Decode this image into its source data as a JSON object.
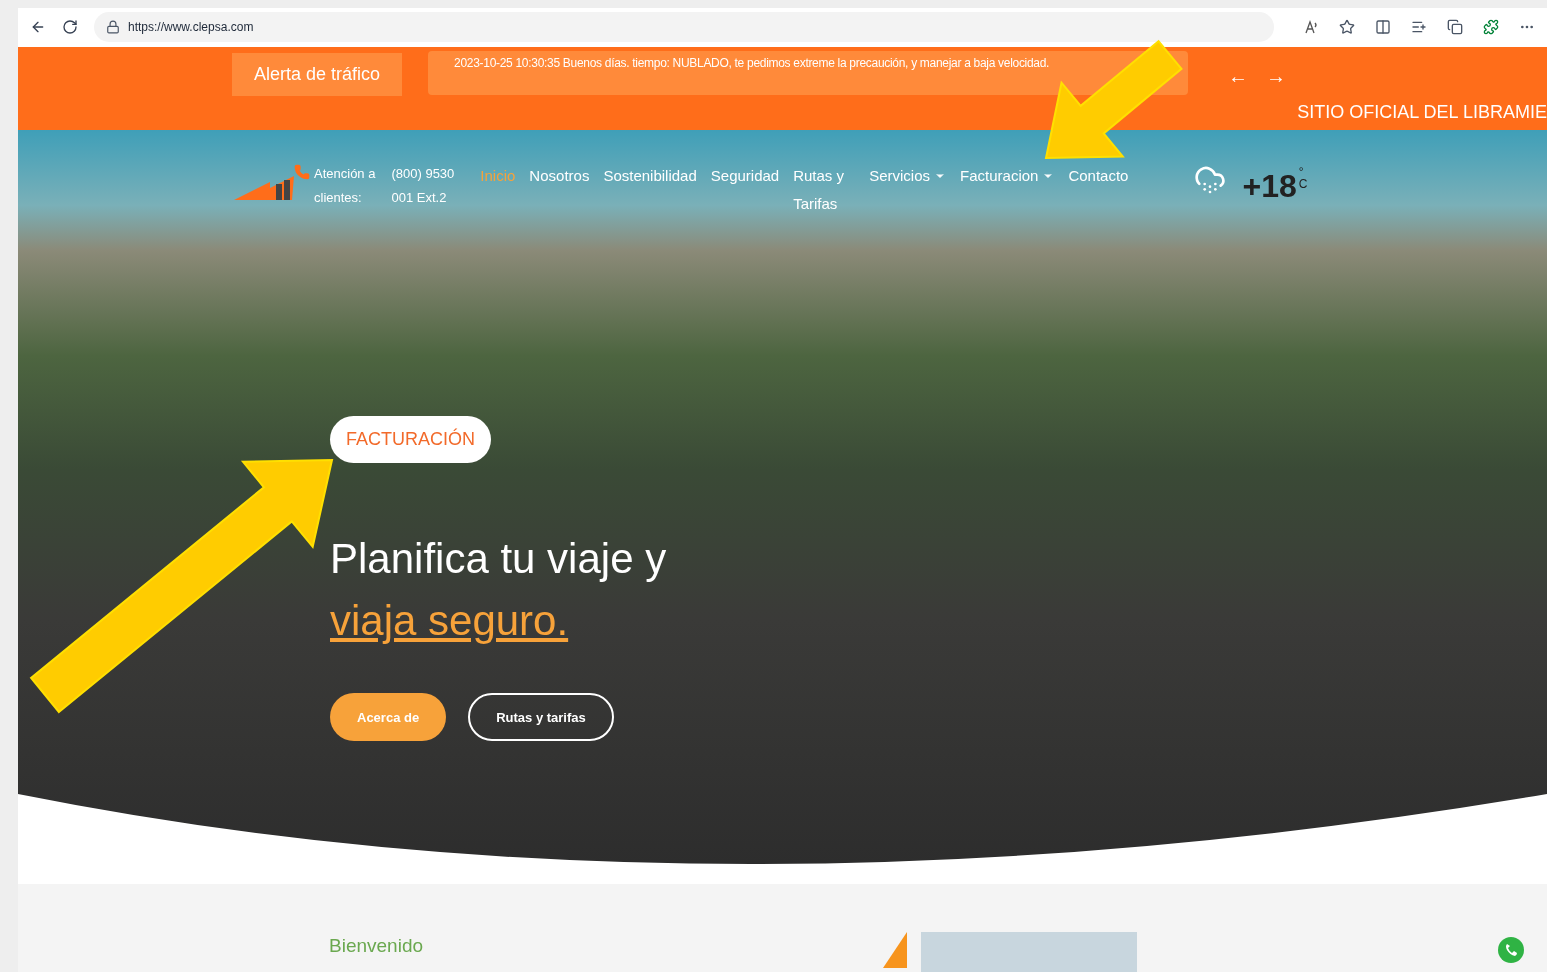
{
  "browser": {
    "url": "https://www.clepsa.com"
  },
  "alert_bar": {
    "label": "Alerta de tráfico",
    "message": "2023-10-25 10:30:35 Buenos días. tiempo: NUBLADO, te pedimos extreme la precaución, y manejar a baja velocidad.",
    "prev": "←",
    "next": "→",
    "tagline": "SITIO OFICIAL DEL LIBRAMIE"
  },
  "contact": {
    "label_lines": [
      "Atención a",
      "clientes:"
    ],
    "phone_lines": [
      "(800) 9530",
      "001 Ext.2"
    ]
  },
  "nav": [
    {
      "label": "Inicio",
      "selected": true,
      "dropdown": false
    },
    {
      "label": "Nosotros",
      "selected": false,
      "dropdown": false
    },
    {
      "label": "Sostenibilidad",
      "selected": false,
      "dropdown": false
    },
    {
      "label": "Seguridad",
      "selected": false,
      "dropdown": false
    },
    {
      "label": "Rutas y Tarifas",
      "selected": false,
      "dropdown": false
    },
    {
      "label": "Servicios",
      "selected": false,
      "dropdown": true
    },
    {
      "label": "Facturacion",
      "selected": false,
      "dropdown": true
    },
    {
      "label": "Contacto",
      "selected": false,
      "dropdown": false
    }
  ],
  "weather": {
    "temperature": "+18",
    "unit": "°C"
  },
  "hero": {
    "badge": "FACTURACIÓN",
    "headline": "Planifica tu viaje y",
    "highlight": "viaja seguro.",
    "buttons": [
      {
        "label": "Acerca de",
        "kind": "filled"
      },
      {
        "label": "Rutas y tarifas",
        "kind": "outline"
      }
    ]
  },
  "welcome": {
    "title": "Bienvenido"
  }
}
